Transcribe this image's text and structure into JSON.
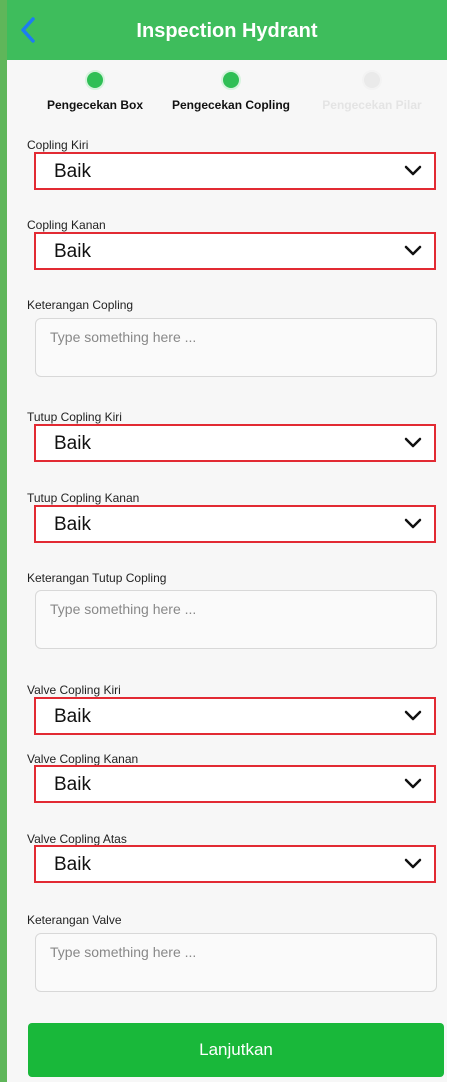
{
  "header": {
    "title": "Inspection Hydrant",
    "back_icon": "chevron-left-icon"
  },
  "steps": [
    {
      "label": "Pengecekan Box",
      "status": "done"
    },
    {
      "label": "Pengecekan Copling",
      "status": "done"
    },
    {
      "label": "Pengecekan Pilar",
      "status": "todo"
    }
  ],
  "form": {
    "copling_kiri": {
      "label": "Copling Kiri",
      "value": "Baik"
    },
    "copling_kanan": {
      "label": "Copling Kanan",
      "value": "Baik"
    },
    "keterangan_copling": {
      "label": "Keterangan Copling",
      "placeholder": "Type something here ..."
    },
    "tutup_copling_kiri": {
      "label": "Tutup Copling Kiri",
      "value": "Baik"
    },
    "tutup_copling_kanan": {
      "label": "Tutup Copling Kanan",
      "value": "Baik"
    },
    "keterangan_tutup_copling": {
      "label": "Keterangan Tutup Copling",
      "placeholder": "Type something here ..."
    },
    "valve_copling_kiri": {
      "label": "Valve Copling Kiri",
      "value": "Baik"
    },
    "valve_copling_kanan": {
      "label": "Valve Copling Kanan",
      "value": "Baik"
    },
    "valve_copling_atas": {
      "label": "Valve Copling Atas",
      "value": "Baik"
    },
    "keterangan_valve": {
      "label": "Keterangan Valve",
      "placeholder": "Type something here ..."
    }
  },
  "footer": {
    "submit_label": "Lanjutkan"
  },
  "colors": {
    "header": "#3ebd5c",
    "accent": "#19b83a",
    "highlight": "#e22a33",
    "back": "#1d7cf2"
  }
}
